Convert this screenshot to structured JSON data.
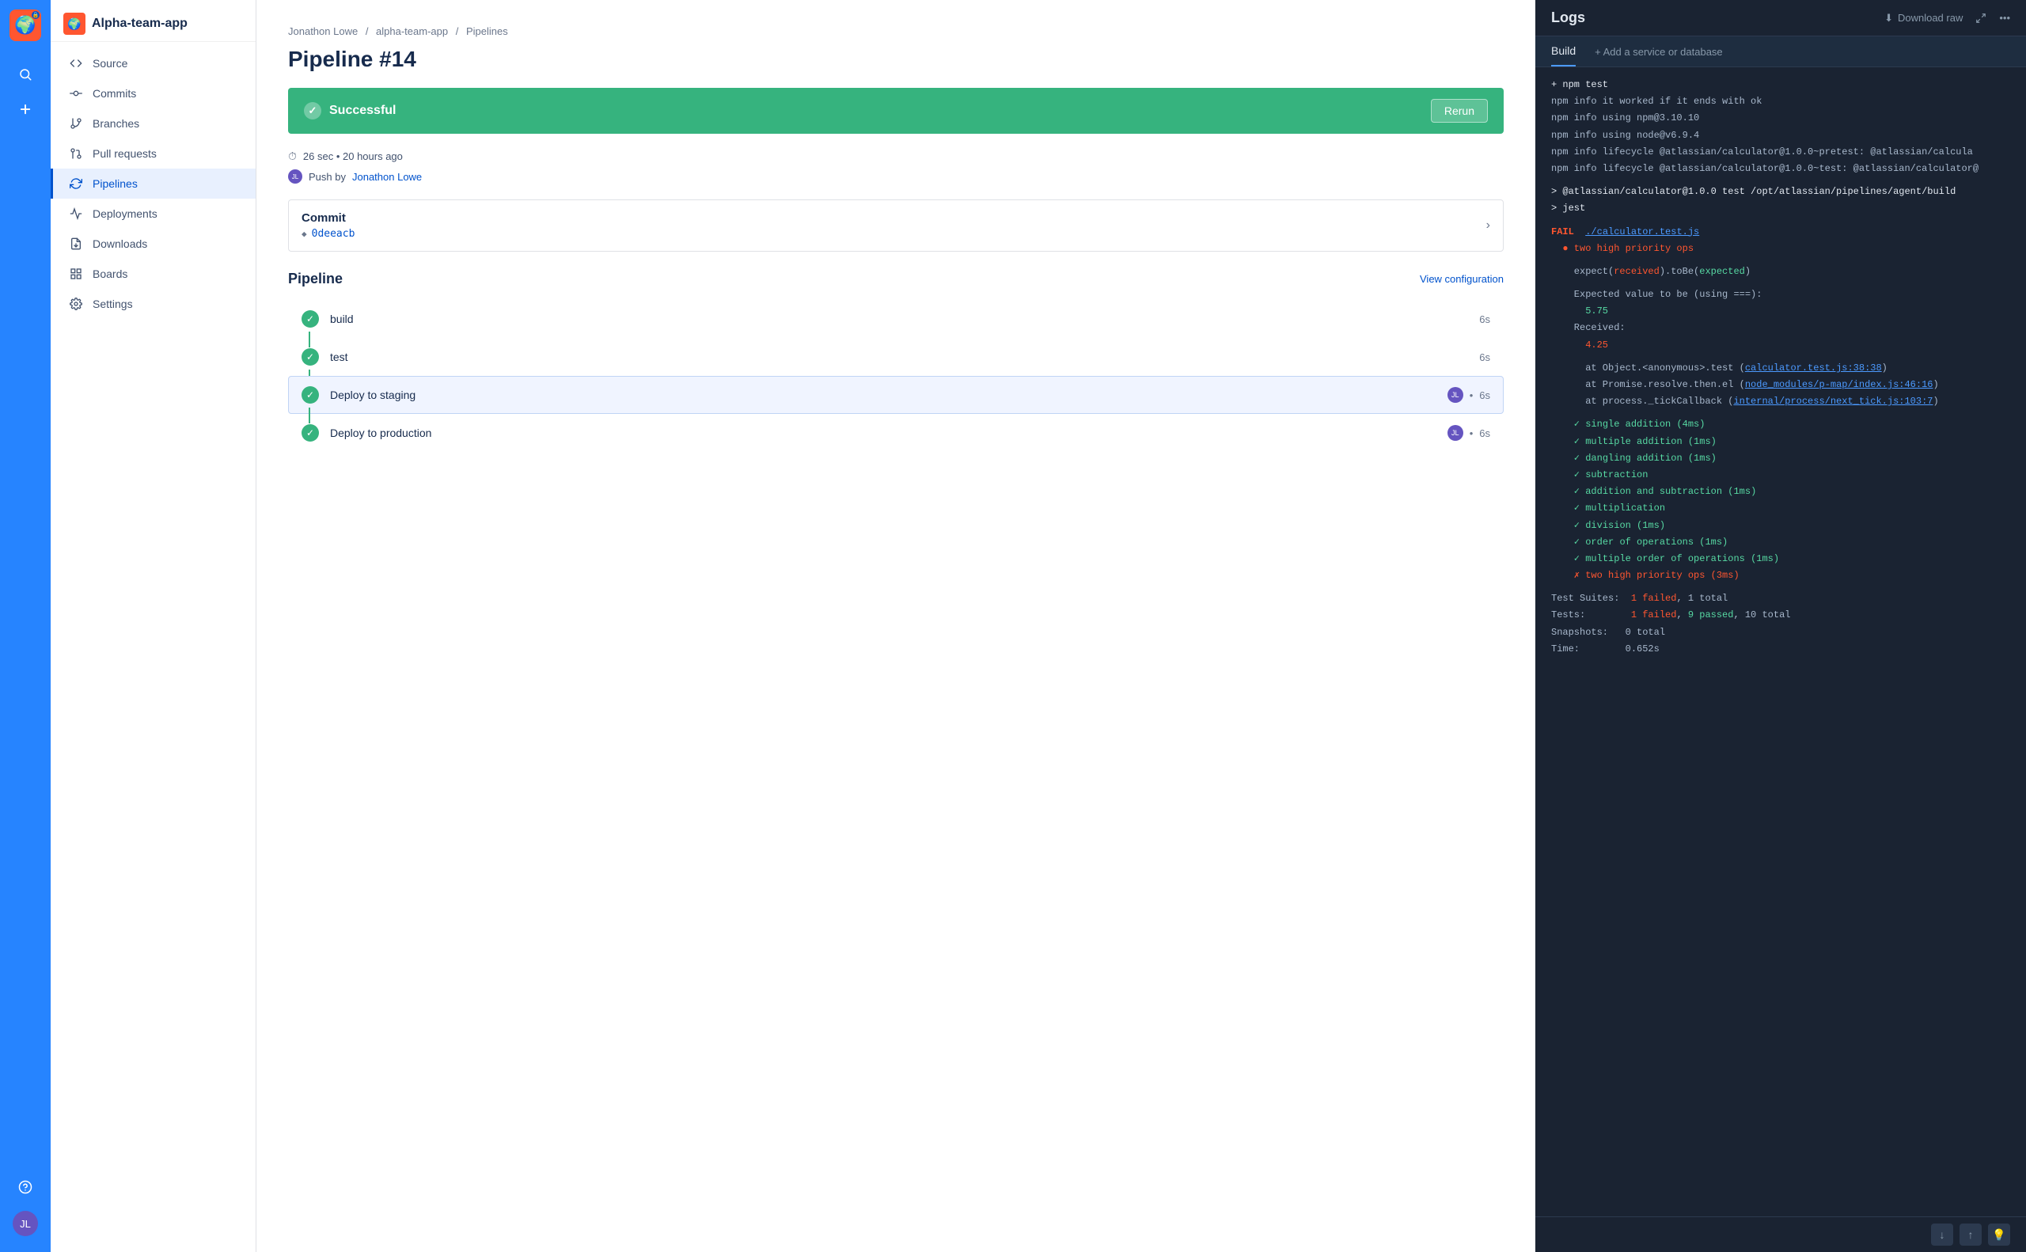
{
  "iconBar": {
    "appLogoEmoji": "🌍",
    "searchIcon": "🔍",
    "addIcon": "+",
    "helpIcon": "?",
    "userInitials": "JL"
  },
  "sidebar": {
    "appName": "Alpha-team-app",
    "navItems": [
      {
        "id": "source",
        "label": "Source",
        "icon": "<>",
        "active": false
      },
      {
        "id": "commits",
        "label": "Commits",
        "icon": "⎇",
        "active": false
      },
      {
        "id": "branches",
        "label": "Branches",
        "icon": "⑂",
        "active": false
      },
      {
        "id": "pull-requests",
        "label": "Pull requests",
        "icon": "⇌",
        "active": false
      },
      {
        "id": "pipelines",
        "label": "Pipelines",
        "icon": "↻",
        "active": true
      },
      {
        "id": "deployments",
        "label": "Deployments",
        "icon": "☁",
        "active": false
      },
      {
        "id": "downloads",
        "label": "Downloads",
        "icon": "⬇",
        "active": false
      },
      {
        "id": "boards",
        "label": "Boards",
        "icon": "☰",
        "active": false
      },
      {
        "id": "settings",
        "label": "Settings",
        "icon": "⚙",
        "active": false
      }
    ]
  },
  "breadcrumb": {
    "user": "Jonathon Lowe",
    "repo": "alpha-team-app",
    "section": "Pipelines"
  },
  "pipeline": {
    "title": "Pipeline #14",
    "status": "Successful",
    "rerunLabel": "Rerun",
    "duration": "26 sec • 20 hours ago",
    "pushedBy": "Push by",
    "pusherName": "Jonathon Lowe",
    "commitTitle": "Commit",
    "commitHash": "0deeacb",
    "pipelineTitle": "Pipeline",
    "viewConfigLabel": "View configuration",
    "steps": [
      {
        "name": "build",
        "time": "6s",
        "hasAvatar": false
      },
      {
        "name": "test",
        "time": "6s",
        "hasAvatar": false
      },
      {
        "name": "Deploy to staging",
        "time": "6s",
        "hasAvatar": true,
        "active": true
      },
      {
        "name": "Deploy to production",
        "time": "6s",
        "hasAvatar": true
      }
    ]
  },
  "logs": {
    "title": "Logs",
    "downloadRawLabel": "Download raw",
    "tabBuild": "Build",
    "addServiceLabel": "+ Add a service or database",
    "content": [
      {
        "type": "cmd",
        "text": "+ npm test"
      },
      {
        "type": "normal",
        "text": "npm info it worked if it ends with ok"
      },
      {
        "type": "normal",
        "text": "npm info using npm@3.10.10"
      },
      {
        "type": "normal",
        "text": "npm info using node@v6.9.4"
      },
      {
        "type": "normal",
        "text": "npm info lifecycle @atlassian/calculator@1.0.0~pretest: @atlassian/calcula"
      },
      {
        "type": "normal",
        "text": "npm info lifecycle @atlassian/calculator@1.0.0~test: @atlassian/calculator"
      },
      {
        "type": "empty"
      },
      {
        "type": "cmd",
        "text": "> @atlassian/calculator@1.0.0 test /opt/atlassian/pipelines/agent/build"
      },
      {
        "type": "cmd",
        "text": "> jest"
      },
      {
        "type": "empty"
      },
      {
        "type": "fail",
        "text": "FAIL  ./calculator.test.js"
      },
      {
        "type": "red-bullet",
        "text": "  ● two high priority ops"
      },
      {
        "type": "empty"
      },
      {
        "type": "normal",
        "text": "    expect(received).toBe(expected)"
      },
      {
        "type": "empty"
      },
      {
        "type": "normal",
        "text": "    Expected value to be (using ===):"
      },
      {
        "type": "expected",
        "text": "      5.75"
      },
      {
        "type": "normal",
        "text": "    Received:"
      },
      {
        "type": "received",
        "text": "      4.25"
      },
      {
        "type": "empty"
      },
      {
        "type": "stack",
        "text": "      at Object.<anonymous>.test (calculator.test.js:38:38)"
      },
      {
        "type": "stack",
        "text": "      at Promise.resolve.then.el (node_modules/p-map/index.js:46:16)"
      },
      {
        "type": "stack",
        "text": "      at process._tickCallback (internal/process/next_tick.js:103:7)"
      },
      {
        "type": "empty"
      },
      {
        "type": "check",
        "text": "  ✓ single addition (4ms)"
      },
      {
        "type": "check",
        "text": "  ✓ multiple addition (1ms)"
      },
      {
        "type": "check",
        "text": "  ✓ dangling addition (1ms)"
      },
      {
        "type": "check",
        "text": "  ✓ subtraction"
      },
      {
        "type": "check",
        "text": "  ✓ addition and subtraction (1ms)"
      },
      {
        "type": "check",
        "text": "  ✓ multiplication"
      },
      {
        "type": "check",
        "text": "  ✓ division (1ms)"
      },
      {
        "type": "check",
        "text": "  ✓ order of operations (1ms)"
      },
      {
        "type": "check",
        "text": "  ✓ multiple order of operations (1ms)"
      },
      {
        "type": "cross",
        "text": "  ✗ two high priority ops (3ms)"
      },
      {
        "type": "empty"
      },
      {
        "type": "suite-fail",
        "text": "Test Suites:  1 failed, 1 total"
      },
      {
        "type": "test-fail",
        "text": "Tests:        1 failed, 9 passed, 10 total"
      },
      {
        "type": "normal",
        "text": "Snapshots:    0 total"
      },
      {
        "type": "normal",
        "text": "Time:         0.652s"
      }
    ]
  }
}
